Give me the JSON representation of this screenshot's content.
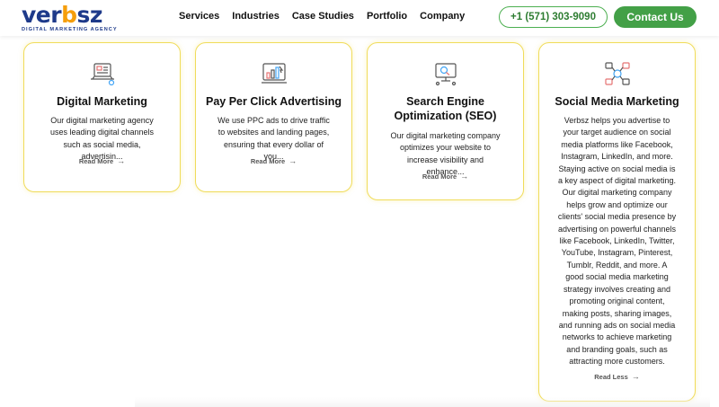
{
  "header": {
    "logo_text_a": "ver",
    "logo_text_b": "b",
    "logo_text_c": "sz",
    "logo_tagline": "DIGITAL MARKETING AGENCY",
    "nav": [
      "Services",
      "Industries",
      "Case Studies",
      "Portfolio",
      "Company"
    ],
    "phone": "+1 (571) 303-9090",
    "contact": "Contact Us"
  },
  "colors": {
    "brand_navy": "#1e3a8a",
    "accent_orange": "#f59e0b",
    "green": "#43a047",
    "card_border": "#f0dc5a"
  },
  "cards": [
    {
      "icon": "digital-marketing-icon",
      "title": "Digital Marketing",
      "desc": "Our digital marketing agency uses leading digital channels such as social media, advertisin...",
      "link": "Read More"
    },
    {
      "icon": "ppc-chart-icon",
      "title": "Pay Per Click Advertising",
      "desc": "We use PPC ads to drive traffic to websites and landing pages, ensuring that every dollar of you...",
      "link": "Read More"
    },
    {
      "icon": "seo-monitor-icon",
      "title": "Search Engine Optimization (SEO)",
      "desc": "Our digital marketing company optimizes your website to increase visibility and enhance...",
      "link": "Read More"
    },
    {
      "icon": "social-network-icon",
      "title": "Social Media Marketing",
      "desc": "Verbsz helps you advertise to your target audience on social media platforms like Facebook, Instagram, LinkedIn, and more. Staying active on social media is a key aspect of digital marketing. Our digital marketing company helps grow and optimize our clients' social media presence by advertising on powerful channels like Facebook, LinkedIn, Twitter, YouTube, Instagram, Pinterest, Tumblr, Reddit, and more. A good social media marketing strategy involves creating and promoting original content, making posts, sharing images, and running ads on social media networks to achieve marketing and branding goals, such as attracting more customers.",
      "link": "Read Less"
    }
  ]
}
